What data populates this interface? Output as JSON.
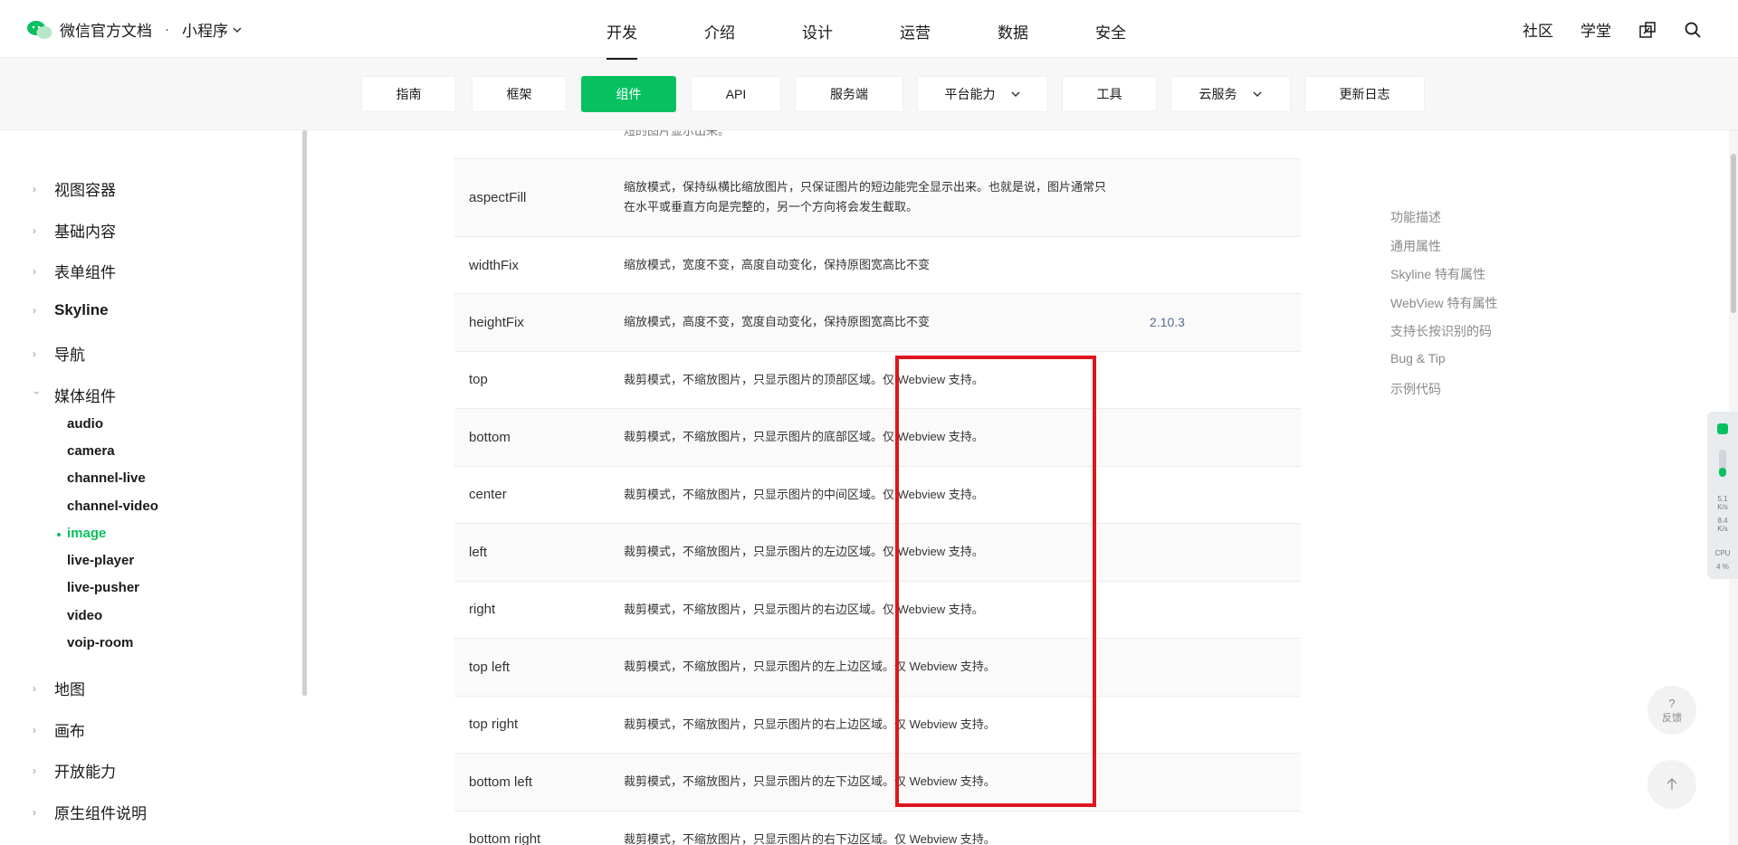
{
  "header": {
    "logo_text": "微信官方文档",
    "separator": "·",
    "product": "小程序",
    "main_tabs": [
      "开发",
      "介绍",
      "设计",
      "运营",
      "数据",
      "安全"
    ],
    "right_links": [
      "社区",
      "学堂"
    ]
  },
  "subnav": {
    "tabs": [
      "指南",
      "框架",
      "组件",
      "API",
      "服务端",
      "平台能力",
      "工具",
      "云服务",
      "更新日志"
    ]
  },
  "sidebar": {
    "sections_top": [
      "视图容器",
      "基础内容",
      "表单组件",
      "Skyline",
      "导航",
      "媒体组件"
    ],
    "media_items": [
      "audio",
      "camera",
      "channel-live",
      "channel-video",
      "image",
      "live-player",
      "live-pusher",
      "video",
      "voip-room"
    ],
    "sections_bottom": [
      "地图",
      "画布",
      "开放能力",
      "原生组件说明"
    ]
  },
  "table": {
    "partial_top": "短的图片显示出来。",
    "rows": [
      {
        "key": "aspectFill",
        "desc": "缩放模式，保持纵横比缩放图片，只保证图片的短边能完全显示出来。也就是说，图片通常只在水平或垂直方向是完整的，另一个方向将会发生截取。",
        "ver": ""
      },
      {
        "key": "widthFix",
        "desc": "缩放模式，宽度不变，高度自动变化，保持原图宽高比不变",
        "ver": ""
      },
      {
        "key": "heightFix",
        "desc": "缩放模式，高度不变，宽度自动变化，保持原图宽高比不变",
        "ver": "2.10.3"
      },
      {
        "key": "top",
        "desc": "裁剪模式，不缩放图片，只显示图片的顶部区域。仅 Webview 支持。",
        "ver": ""
      },
      {
        "key": "bottom",
        "desc": "裁剪模式，不缩放图片，只显示图片的底部区域。仅 Webview 支持。",
        "ver": ""
      },
      {
        "key": "center",
        "desc": "裁剪模式，不缩放图片，只显示图片的中间区域。仅 Webview 支持。",
        "ver": ""
      },
      {
        "key": "left",
        "desc": "裁剪模式，不缩放图片，只显示图片的左边区域。仅 Webview 支持。",
        "ver": ""
      },
      {
        "key": "right",
        "desc": "裁剪模式，不缩放图片，只显示图片的右边区域。仅 Webview 支持。",
        "ver": ""
      },
      {
        "key": "top left",
        "desc": "裁剪模式，不缩放图片，只显示图片的左上边区域。仅 Webview 支持。",
        "ver": ""
      },
      {
        "key": "top right",
        "desc": "裁剪模式，不缩放图片，只显示图片的右上边区域。仅 Webview 支持。",
        "ver": ""
      },
      {
        "key": "bottom left",
        "desc": "裁剪模式，不缩放图片，只显示图片的左下边区域。仅 Webview 支持。",
        "ver": ""
      },
      {
        "key": "bottom right",
        "desc": "裁剪模式，不缩放图片，只显示图片的右下边区域。仅 Webview 支持。",
        "ver": ""
      }
    ]
  },
  "toc": [
    "功能描述",
    "通用属性",
    "Skyline 特有属性",
    "WebView 特有属性",
    "支持长按识别的码",
    "Bug & Tip",
    "示例代码"
  ],
  "monitor": {
    "up": "5.1",
    "up_unit": "K/s",
    "down": "8.4",
    "down_unit": "K/s",
    "cpu_label": "CPU",
    "cpu": "4 %"
  },
  "feedback": {
    "icon": "?",
    "label": "反馈"
  },
  "colors": {
    "accent": "#07c160",
    "highlight_box": "#e0161e",
    "version_link": "#576b95"
  }
}
